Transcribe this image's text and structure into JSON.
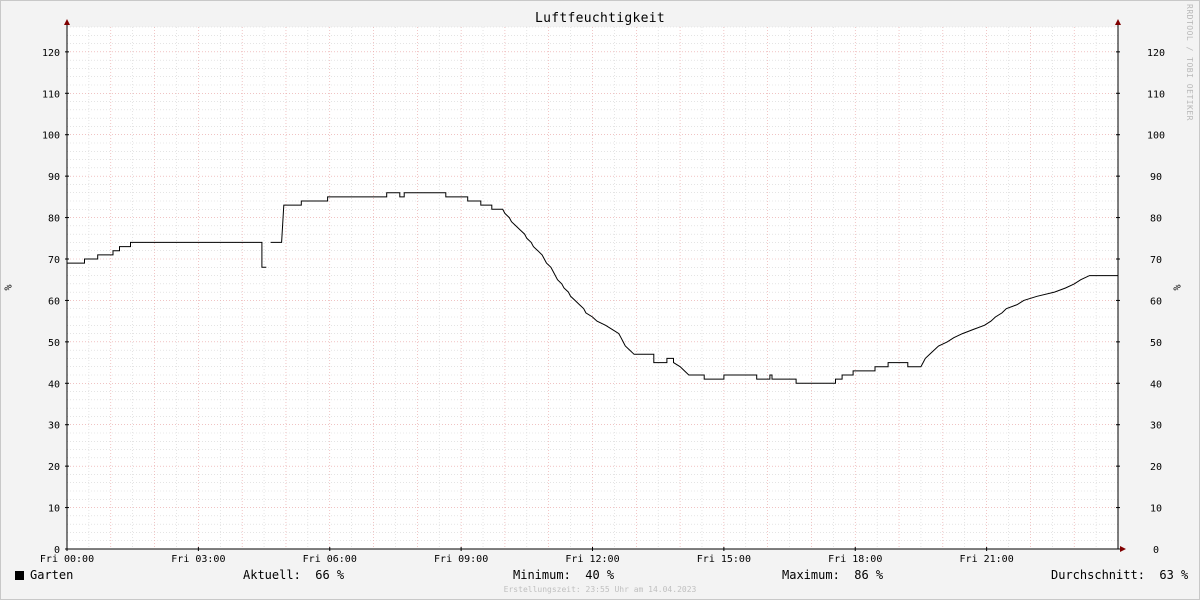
{
  "chart_data": {
    "type": "line",
    "title": "Luftfeuchtigkeit",
    "ylabel": "%",
    "ylim": [
      0,
      126
    ],
    "yticks": [
      0,
      10,
      20,
      30,
      40,
      50,
      60,
      70,
      80,
      90,
      100,
      110,
      120
    ],
    "xlim": [
      0,
      24
    ],
    "xticks": [
      {
        "hour": 0,
        "label": "Fri 00:00"
      },
      {
        "hour": 3,
        "label": "Fri 03:00"
      },
      {
        "hour": 6,
        "label": "Fri 06:00"
      },
      {
        "hour": 9,
        "label": "Fri 09:00"
      },
      {
        "hour": 12,
        "label": "Fri 12:00"
      },
      {
        "hour": 15,
        "label": "Fri 15:00"
      },
      {
        "hour": 18,
        "label": "Fri 18:00"
      },
      {
        "hour": 21,
        "label": "Fri 21:00"
      }
    ],
    "grid": true,
    "series": [
      {
        "name": "Garten",
        "color": "#000000",
        "segments": [
          [
            [
              0.0,
              69
            ],
            [
              0.4,
              69
            ],
            [
              0.4,
              70
            ],
            [
              0.7,
              70
            ],
            [
              0.7,
              71
            ],
            [
              1.05,
              71
            ],
            [
              1.05,
              72
            ],
            [
              1.2,
              72
            ],
            [
              1.2,
              73
            ],
            [
              1.45,
              73
            ],
            [
              1.45,
              74
            ],
            [
              4.45,
              74
            ],
            [
              4.45,
              68
            ],
            [
              4.55,
              68
            ]
          ],
          [
            [
              4.65,
              74
            ],
            [
              4.9,
              74
            ],
            [
              4.95,
              83
            ],
            [
              5.05,
              83
            ],
            [
              5.05,
              83
            ],
            [
              5.35,
              83
            ],
            [
              5.35,
              84
            ],
            [
              5.95,
              84
            ],
            [
              5.95,
              85
            ],
            [
              7.3,
              85
            ],
            [
              7.3,
              86
            ],
            [
              7.6,
              86
            ],
            [
              7.6,
              85
            ],
            [
              7.7,
              85
            ],
            [
              7.7,
              86
            ],
            [
              8.65,
              86
            ],
            [
              8.65,
              85
            ],
            [
              9.15,
              85
            ],
            [
              9.15,
              84
            ],
            [
              9.45,
              84
            ],
            [
              9.45,
              83
            ],
            [
              9.7,
              83
            ],
            [
              9.7,
              82
            ],
            [
              9.95,
              82
            ],
            [
              10.0,
              81
            ],
            [
              10.1,
              80
            ],
            [
              10.15,
              79
            ],
            [
              10.25,
              78
            ],
            [
              10.35,
              77
            ],
            [
              10.45,
              76
            ],
            [
              10.5,
              75
            ],
            [
              10.6,
              74
            ],
            [
              10.65,
              73
            ],
            [
              10.75,
              72
            ],
            [
              10.85,
              71
            ],
            [
              10.9,
              70
            ],
            [
              10.95,
              69
            ],
            [
              11.05,
              68
            ],
            [
              11.1,
              67
            ],
            [
              11.2,
              65
            ],
            [
              11.3,
              64
            ],
            [
              11.35,
              63
            ],
            [
              11.45,
              62
            ],
            [
              11.5,
              61
            ],
            [
              11.6,
              60
            ],
            [
              11.7,
              59
            ],
            [
              11.8,
              58
            ],
            [
              11.85,
              57
            ],
            [
              12.0,
              56
            ],
            [
              12.1,
              55
            ],
            [
              12.3,
              54
            ],
            [
              12.45,
              53
            ],
            [
              12.6,
              52
            ],
            [
              12.65,
              51
            ],
            [
              12.7,
              50
            ],
            [
              12.75,
              49
            ],
            [
              12.85,
              48
            ],
            [
              12.95,
              47
            ],
            [
              13.4,
              47
            ],
            [
              13.4,
              45
            ],
            [
              13.7,
              45
            ],
            [
              13.7,
              46
            ],
            [
              13.85,
              46
            ],
            [
              13.85,
              45
            ],
            [
              14.0,
              44
            ],
            [
              14.1,
              43
            ],
            [
              14.2,
              42
            ],
            [
              14.55,
              42
            ],
            [
              14.55,
              41
            ],
            [
              15.0,
              41
            ],
            [
              15.0,
              42
            ],
            [
              15.75,
              42
            ],
            [
              15.75,
              41
            ],
            [
              16.05,
              41
            ],
            [
              16.05,
              42
            ],
            [
              16.1,
              42
            ],
            [
              16.1,
              41
            ],
            [
              16.65,
              41
            ],
            [
              16.65,
              40
            ],
            [
              17.55,
              40
            ],
            [
              17.55,
              41
            ],
            [
              17.7,
              41
            ],
            [
              17.7,
              42
            ],
            [
              17.95,
              42
            ],
            [
              17.95,
              43
            ],
            [
              18.45,
              43
            ],
            [
              18.45,
              44
            ],
            [
              18.75,
              44
            ],
            [
              18.75,
              45
            ],
            [
              19.2,
              45
            ],
            [
              19.2,
              44
            ],
            [
              19.5,
              44
            ],
            [
              19.55,
              45
            ],
            [
              19.6,
              46
            ],
            [
              19.7,
              47
            ],
            [
              19.8,
              48
            ],
            [
              19.9,
              49
            ],
            [
              20.1,
              50
            ],
            [
              20.25,
              51
            ],
            [
              20.45,
              52
            ],
            [
              20.7,
              53
            ],
            [
              20.95,
              54
            ],
            [
              21.1,
              55
            ],
            [
              21.2,
              56
            ],
            [
              21.35,
              57
            ],
            [
              21.45,
              58
            ],
            [
              21.7,
              59
            ],
            [
              21.85,
              60
            ],
            [
              22.15,
              61
            ],
            [
              22.55,
              62
            ],
            [
              22.8,
              63
            ],
            [
              23.0,
              64
            ],
            [
              23.15,
              65
            ],
            [
              23.35,
              66
            ],
            [
              24.0,
              66
            ]
          ]
        ]
      }
    ]
  },
  "legend": {
    "series_name": "Garten",
    "current_label": "Aktuell:",
    "current_value": "66 %",
    "min_label": "Minimum:",
    "min_value": "40 %",
    "max_label": "Maximum:",
    "max_value": "86 %",
    "avg_label": "Durchschnitt:",
    "avg_value": "63 %"
  },
  "footer": "Erstellungszeit: 23:55 Uhr am 14.04.2023",
  "watermark": "RRDTOOL / TOBI OETIKER",
  "colors": {
    "background": "#f3f3f3",
    "plot_background": "#ffffff",
    "major_grid": "#e8a0a0",
    "minor_grid": "#d4d4d4",
    "axis": "#000000",
    "arrow": "#800000"
  }
}
